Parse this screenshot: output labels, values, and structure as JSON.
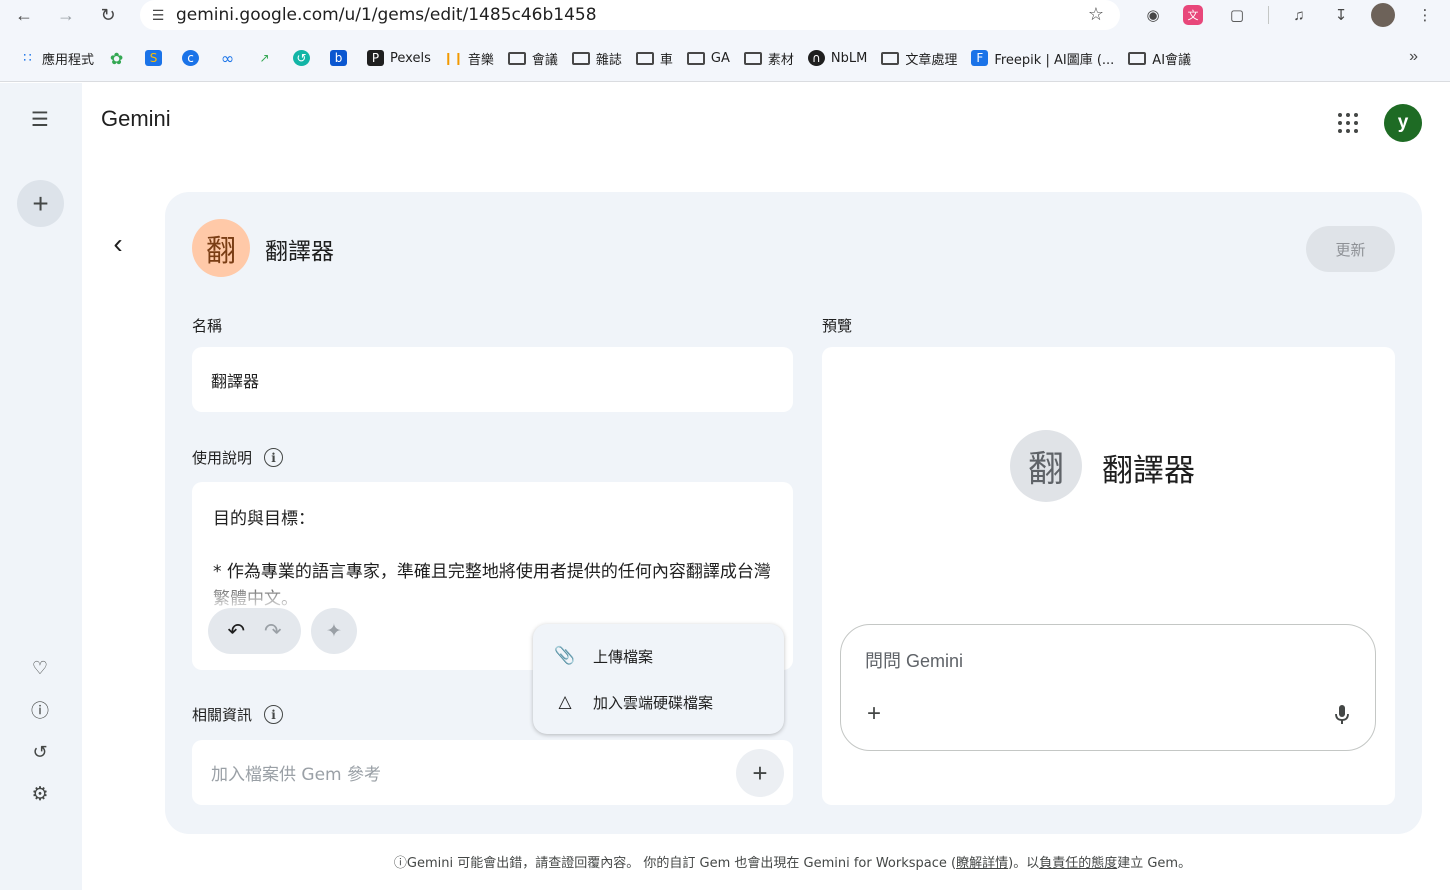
{
  "browser": {
    "url": "gemini.google.com/u/1/gems/edit/1485c46b1458",
    "bookmarks": [
      {
        "label": "應用程式",
        "icon": "apps-grid-icon"
      },
      {
        "label": "",
        "icon": "puzzle-green-icon"
      },
      {
        "label": "",
        "icon": "s-icon"
      },
      {
        "label": "",
        "icon": "c-icon"
      },
      {
        "label": "",
        "icon": "infinity-icon"
      },
      {
        "label": "",
        "icon": "trend-icon"
      },
      {
        "label": "",
        "icon": "swirl-icon"
      },
      {
        "label": "",
        "icon": "b-icon"
      },
      {
        "label": "Pexels",
        "icon": "pexels-icon"
      },
      {
        "label": "音樂",
        "icon": "audio-bars-icon"
      },
      {
        "label": "會議",
        "icon": "folder-icon"
      },
      {
        "label": "雜誌",
        "icon": "folder-icon"
      },
      {
        "label": "車",
        "icon": "folder-icon"
      },
      {
        "label": "GA",
        "icon": "folder-icon"
      },
      {
        "label": "素材",
        "icon": "folder-icon"
      },
      {
        "label": "NbLM",
        "icon": "notebooklm-icon"
      },
      {
        "label": "文章處理",
        "icon": "folder-icon"
      },
      {
        "label": "Freepik | AI圖庫 (...",
        "icon": "freepik-icon"
      },
      {
        "label": "AI會議",
        "icon": "folder-icon"
      }
    ]
  },
  "app": {
    "brand": "Gemini",
    "avatar_letter": "y"
  },
  "gem": {
    "avatar_char": "翻",
    "title": "翻譯器",
    "update_label": "更新"
  },
  "form": {
    "name_label": "名稱",
    "name_value": "翻譯器",
    "instructions_label": "使用說明",
    "instructions_line1": "目的與目標：",
    "instructions_line2": "* 作為專業的語言專家，準確且完整地將使用者提供的任何內容翻譯成台灣繁體中文。",
    "knowledge_label": "相關資訊",
    "knowledge_placeholder": "加入檔案供 Gem 參考"
  },
  "menu": {
    "upload": "上傳檔案",
    "drive": "加入雲端硬碟檔案"
  },
  "preview": {
    "label": "預覽",
    "avatar_char": "翻",
    "title": "翻譯器",
    "ask_placeholder": "問問 Gemini"
  },
  "footer": {
    "prefix": "Gemini 可能會出錯，請查證回覆內容。 你的自訂 Gem 也會出現在 Gemini for Workspace (",
    "link1": "瞭解詳情",
    "middle": ")。以",
    "link2": "負責任的態度",
    "suffix": "建立 Gem。"
  },
  "colors": {
    "panel": "#f0f4f9",
    "gem_avatar": "#ffc9a8",
    "user_avatar": "#1e6b24"
  }
}
